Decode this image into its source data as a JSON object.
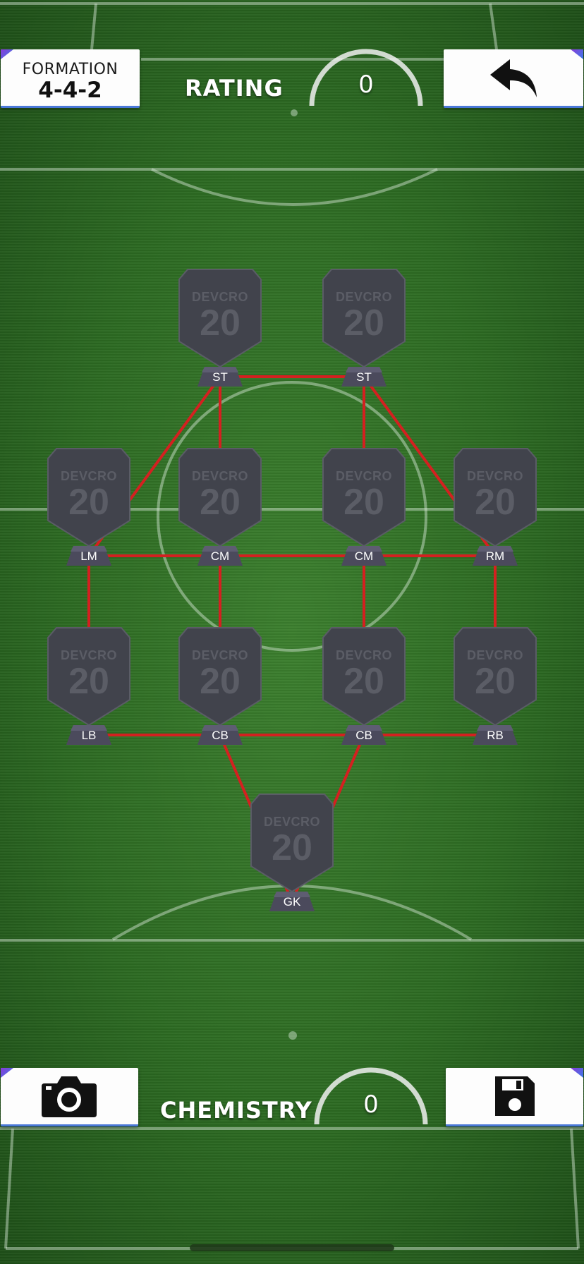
{
  "header": {
    "formation_label": "FORMATION",
    "formation_value": "4-4-2",
    "rating_label": "RATING",
    "rating_value": "0",
    "back_icon": "undo-arrow-icon"
  },
  "footer": {
    "chemistry_label": "CHEMISTRY",
    "chemistry_value": "0",
    "camera_icon": "camera-icon",
    "save_icon": "save-floppy-icon"
  },
  "colors": {
    "pitch": "#2d6e24",
    "chemistry_link": "#d42020",
    "card": "#41434c",
    "panel_accent": "#4a78d8"
  },
  "players": [
    {
      "pos": "ST",
      "brand": "DEVCRO",
      "rating": "20"
    },
    {
      "pos": "ST",
      "brand": "DEVCRO",
      "rating": "20"
    },
    {
      "pos": "LM",
      "brand": "DEVCRO",
      "rating": "20"
    },
    {
      "pos": "CM",
      "brand": "DEVCRO",
      "rating": "20"
    },
    {
      "pos": "CM",
      "brand": "DEVCRO",
      "rating": "20"
    },
    {
      "pos": "RM",
      "brand": "DEVCRO",
      "rating": "20"
    },
    {
      "pos": "LB",
      "brand": "DEVCRO",
      "rating": "20"
    },
    {
      "pos": "CB",
      "brand": "DEVCRO",
      "rating": "20"
    },
    {
      "pos": "CB",
      "brand": "DEVCRO",
      "rating": "20"
    },
    {
      "pos": "RB",
      "brand": "DEVCRO",
      "rating": "20"
    },
    {
      "pos": "GK",
      "brand": "DEVCRO",
      "rating": "20"
    }
  ],
  "links": [
    [
      0,
      1
    ],
    [
      0,
      2
    ],
    [
      0,
      3
    ],
    [
      1,
      4
    ],
    [
      1,
      5
    ],
    [
      2,
      3
    ],
    [
      3,
      4
    ],
    [
      4,
      5
    ],
    [
      2,
      6
    ],
    [
      3,
      7
    ],
    [
      4,
      8
    ],
    [
      5,
      9
    ],
    [
      6,
      7
    ],
    [
      7,
      8
    ],
    [
      8,
      9
    ],
    [
      7,
      10
    ],
    [
      8,
      10
    ]
  ]
}
